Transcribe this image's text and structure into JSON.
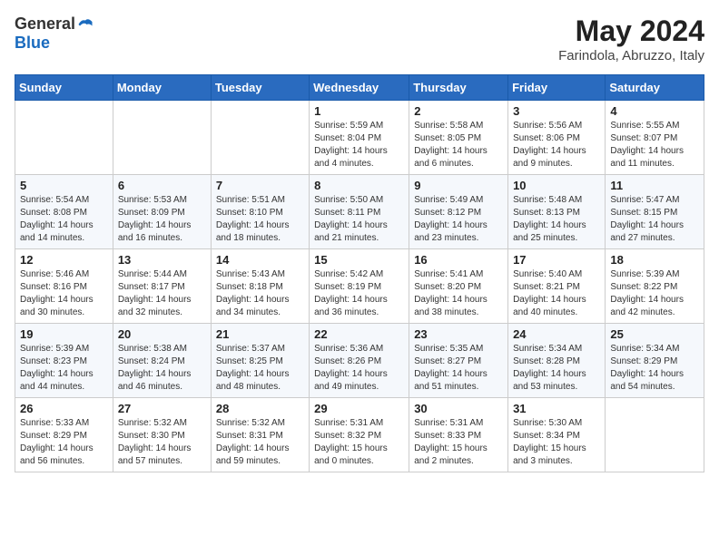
{
  "header": {
    "logo_general": "General",
    "logo_blue": "Blue",
    "month_title": "May 2024",
    "location": "Farindola, Abruzzo, Italy"
  },
  "days_of_week": [
    "Sunday",
    "Monday",
    "Tuesday",
    "Wednesday",
    "Thursday",
    "Friday",
    "Saturday"
  ],
  "weeks": [
    [
      {
        "day": "",
        "sunrise": "",
        "sunset": "",
        "daylight": ""
      },
      {
        "day": "",
        "sunrise": "",
        "sunset": "",
        "daylight": ""
      },
      {
        "day": "",
        "sunrise": "",
        "sunset": "",
        "daylight": ""
      },
      {
        "day": "1",
        "sunrise": "Sunrise: 5:59 AM",
        "sunset": "Sunset: 8:04 PM",
        "daylight": "Daylight: 14 hours and 4 minutes."
      },
      {
        "day": "2",
        "sunrise": "Sunrise: 5:58 AM",
        "sunset": "Sunset: 8:05 PM",
        "daylight": "Daylight: 14 hours and 6 minutes."
      },
      {
        "day": "3",
        "sunrise": "Sunrise: 5:56 AM",
        "sunset": "Sunset: 8:06 PM",
        "daylight": "Daylight: 14 hours and 9 minutes."
      },
      {
        "day": "4",
        "sunrise": "Sunrise: 5:55 AM",
        "sunset": "Sunset: 8:07 PM",
        "daylight": "Daylight: 14 hours and 11 minutes."
      }
    ],
    [
      {
        "day": "5",
        "sunrise": "Sunrise: 5:54 AM",
        "sunset": "Sunset: 8:08 PM",
        "daylight": "Daylight: 14 hours and 14 minutes."
      },
      {
        "day": "6",
        "sunrise": "Sunrise: 5:53 AM",
        "sunset": "Sunset: 8:09 PM",
        "daylight": "Daylight: 14 hours and 16 minutes."
      },
      {
        "day": "7",
        "sunrise": "Sunrise: 5:51 AM",
        "sunset": "Sunset: 8:10 PM",
        "daylight": "Daylight: 14 hours and 18 minutes."
      },
      {
        "day": "8",
        "sunrise": "Sunrise: 5:50 AM",
        "sunset": "Sunset: 8:11 PM",
        "daylight": "Daylight: 14 hours and 21 minutes."
      },
      {
        "day": "9",
        "sunrise": "Sunrise: 5:49 AM",
        "sunset": "Sunset: 8:12 PM",
        "daylight": "Daylight: 14 hours and 23 minutes."
      },
      {
        "day": "10",
        "sunrise": "Sunrise: 5:48 AM",
        "sunset": "Sunset: 8:13 PM",
        "daylight": "Daylight: 14 hours and 25 minutes."
      },
      {
        "day": "11",
        "sunrise": "Sunrise: 5:47 AM",
        "sunset": "Sunset: 8:15 PM",
        "daylight": "Daylight: 14 hours and 27 minutes."
      }
    ],
    [
      {
        "day": "12",
        "sunrise": "Sunrise: 5:46 AM",
        "sunset": "Sunset: 8:16 PM",
        "daylight": "Daylight: 14 hours and 30 minutes."
      },
      {
        "day": "13",
        "sunrise": "Sunrise: 5:44 AM",
        "sunset": "Sunset: 8:17 PM",
        "daylight": "Daylight: 14 hours and 32 minutes."
      },
      {
        "day": "14",
        "sunrise": "Sunrise: 5:43 AM",
        "sunset": "Sunset: 8:18 PM",
        "daylight": "Daylight: 14 hours and 34 minutes."
      },
      {
        "day": "15",
        "sunrise": "Sunrise: 5:42 AM",
        "sunset": "Sunset: 8:19 PM",
        "daylight": "Daylight: 14 hours and 36 minutes."
      },
      {
        "day": "16",
        "sunrise": "Sunrise: 5:41 AM",
        "sunset": "Sunset: 8:20 PM",
        "daylight": "Daylight: 14 hours and 38 minutes."
      },
      {
        "day": "17",
        "sunrise": "Sunrise: 5:40 AM",
        "sunset": "Sunset: 8:21 PM",
        "daylight": "Daylight: 14 hours and 40 minutes."
      },
      {
        "day": "18",
        "sunrise": "Sunrise: 5:39 AM",
        "sunset": "Sunset: 8:22 PM",
        "daylight": "Daylight: 14 hours and 42 minutes."
      }
    ],
    [
      {
        "day": "19",
        "sunrise": "Sunrise: 5:39 AM",
        "sunset": "Sunset: 8:23 PM",
        "daylight": "Daylight: 14 hours and 44 minutes."
      },
      {
        "day": "20",
        "sunrise": "Sunrise: 5:38 AM",
        "sunset": "Sunset: 8:24 PM",
        "daylight": "Daylight: 14 hours and 46 minutes."
      },
      {
        "day": "21",
        "sunrise": "Sunrise: 5:37 AM",
        "sunset": "Sunset: 8:25 PM",
        "daylight": "Daylight: 14 hours and 48 minutes."
      },
      {
        "day": "22",
        "sunrise": "Sunrise: 5:36 AM",
        "sunset": "Sunset: 8:26 PM",
        "daylight": "Daylight: 14 hours and 49 minutes."
      },
      {
        "day": "23",
        "sunrise": "Sunrise: 5:35 AM",
        "sunset": "Sunset: 8:27 PM",
        "daylight": "Daylight: 14 hours and 51 minutes."
      },
      {
        "day": "24",
        "sunrise": "Sunrise: 5:34 AM",
        "sunset": "Sunset: 8:28 PM",
        "daylight": "Daylight: 14 hours and 53 minutes."
      },
      {
        "day": "25",
        "sunrise": "Sunrise: 5:34 AM",
        "sunset": "Sunset: 8:29 PM",
        "daylight": "Daylight: 14 hours and 54 minutes."
      }
    ],
    [
      {
        "day": "26",
        "sunrise": "Sunrise: 5:33 AM",
        "sunset": "Sunset: 8:29 PM",
        "daylight": "Daylight: 14 hours and 56 minutes."
      },
      {
        "day": "27",
        "sunrise": "Sunrise: 5:32 AM",
        "sunset": "Sunset: 8:30 PM",
        "daylight": "Daylight: 14 hours and 57 minutes."
      },
      {
        "day": "28",
        "sunrise": "Sunrise: 5:32 AM",
        "sunset": "Sunset: 8:31 PM",
        "daylight": "Daylight: 14 hours and 59 minutes."
      },
      {
        "day": "29",
        "sunrise": "Sunrise: 5:31 AM",
        "sunset": "Sunset: 8:32 PM",
        "daylight": "Daylight: 15 hours and 0 minutes."
      },
      {
        "day": "30",
        "sunrise": "Sunrise: 5:31 AM",
        "sunset": "Sunset: 8:33 PM",
        "daylight": "Daylight: 15 hours and 2 minutes."
      },
      {
        "day": "31",
        "sunrise": "Sunrise: 5:30 AM",
        "sunset": "Sunset: 8:34 PM",
        "daylight": "Daylight: 15 hours and 3 minutes."
      },
      {
        "day": "",
        "sunrise": "",
        "sunset": "",
        "daylight": ""
      }
    ]
  ]
}
